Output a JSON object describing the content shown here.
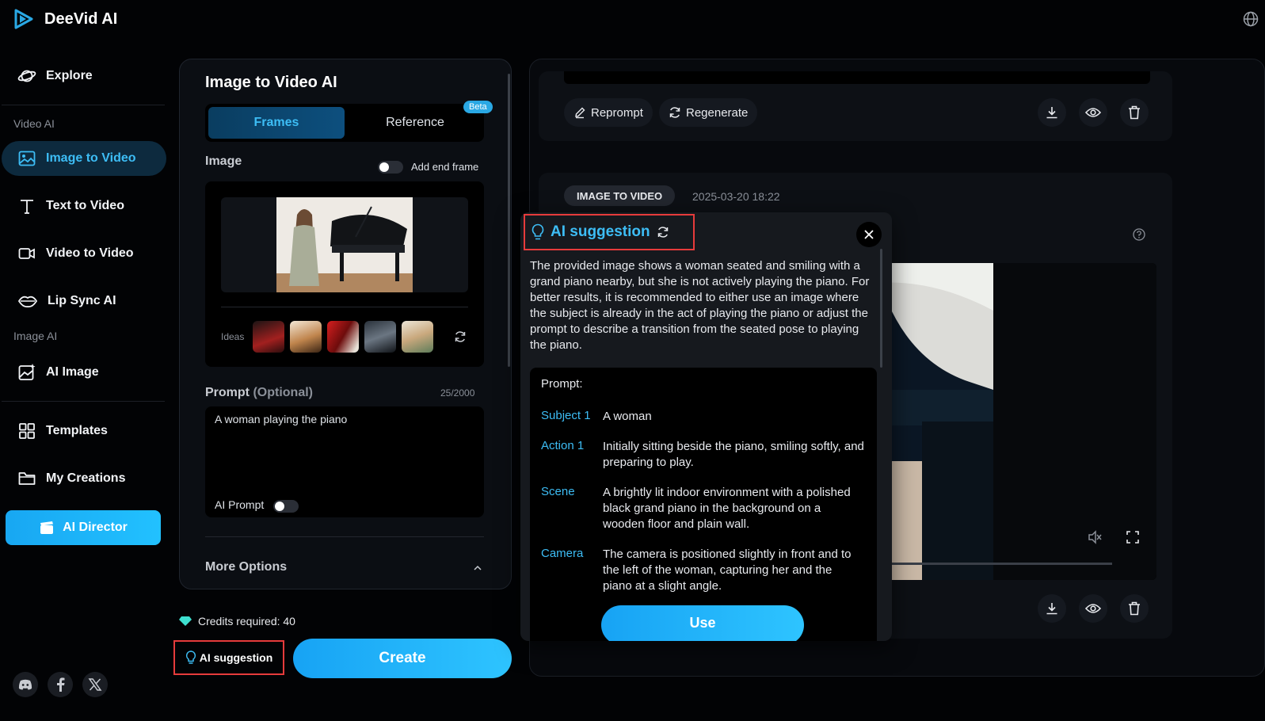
{
  "app": {
    "name": "DeeVid AI"
  },
  "colors": {
    "accent": "#3dbdf5",
    "highlight_border": "#e63b3b"
  },
  "sidebar": {
    "explore": "Explore",
    "section_video": "Video AI",
    "image_to_video": "Image to Video",
    "text_to_video": "Text to Video",
    "video_to_video": "Video to Video",
    "lip_sync": "Lip Sync AI",
    "section_image": "Image AI",
    "ai_image": "AI Image",
    "templates": "Templates",
    "my_creations": "My Creations",
    "ai_director": "AI Director"
  },
  "form": {
    "title": "Image to Video AI",
    "tab_frames": "Frames",
    "tab_reference": "Reference",
    "beta": "Beta",
    "image_label": "Image",
    "add_end_frame": "Add end frame",
    "ideas_label": "Ideas",
    "prompt_label": "Prompt",
    "prompt_optional": "(Optional)",
    "prompt_counter": "25/2000",
    "prompt_value": "A woman playing the piano",
    "ai_prompt": "AI Prompt",
    "more_options": "More Options",
    "credits": "Credits required: 40",
    "ai_suggestion": "AI suggestion",
    "create": "Create"
  },
  "results": {
    "reprompt": "Reprompt",
    "regenerate": "Regenerate",
    "badge": "IMAGE TO VIDEO",
    "date": "2025-03-20 18:22",
    "video_progress": 0.25
  },
  "popup": {
    "title": "AI suggestion",
    "description": "The provided image shows a woman seated and smiling with a grand piano nearby, but she is not actively playing the piano. For better results, it is recommended to either use an image where the subject is already in the act of playing the piano or adjust the prompt to describe a transition from the seated pose to playing the piano.",
    "prompt_heading": "Prompt:",
    "rows": [
      {
        "key": "Subject 1",
        "value": "A woman"
      },
      {
        "key": "Action 1",
        "value": "Initially sitting beside the piano, smiling softly, and preparing to play."
      },
      {
        "key": "Scene",
        "value": "A brightly lit indoor environment with a polished black grand piano in the background on a wooden floor and plain wall."
      },
      {
        "key": "Camera",
        "value": "The camera is positioned slightly in front and to the left of the woman, capturing her and the piano at a slight angle."
      }
    ],
    "use": "Use"
  }
}
